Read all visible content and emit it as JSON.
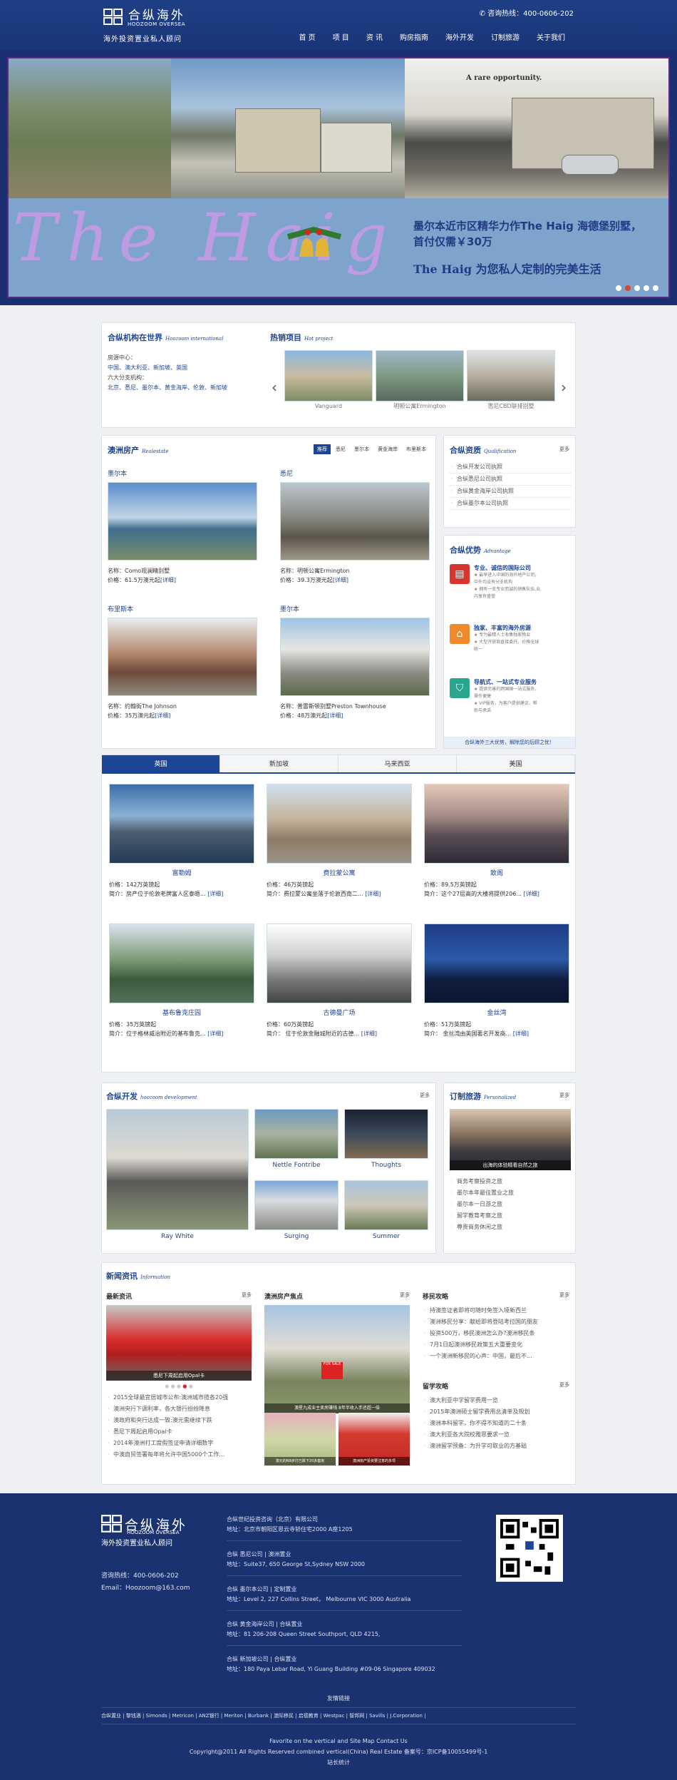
{
  "header": {
    "logo_cn": "合纵海外",
    "logo_en": "HOOZOOM OVERSEA",
    "slogan": "海外投资置业私人顾问",
    "hotline": "咨询热线：400-0606-202",
    "nav": [
      "首 页",
      "项 目",
      "资 讯",
      "购房指南",
      "海外开发",
      "订制旅游",
      "关于我们"
    ]
  },
  "banner": {
    "tagline": "A rare opportunity.",
    "big_text": "The Haig",
    "line1": "墨尔本近市区精华力作The Haig 海德堡别墅，首付仅需￥30万",
    "line2": "The Haig 为您私人定制的完美生活",
    "slides": 5,
    "active": 2
  },
  "intl": {
    "title": "合纵机构在世界",
    "en": "Hoozoom international",
    "label1": "房源中心：",
    "countries1": "中国、澳大利亚、新加坡、英国",
    "label2": "六大分支机构：",
    "countries2": "北京、悉尼、墨尔本、黄金海岸、伦敦、新加坡"
  },
  "hot": {
    "title": "热销项目",
    "en": "Hot project",
    "items": [
      "Vanguard",
      "明顿公寓Ermington",
      "悉尼CBD联排别墅"
    ]
  },
  "realestate": {
    "title": "澳洲房产",
    "en": "Realestate",
    "tabs": [
      "推荐",
      "悉尼",
      "墨尔本",
      "黄金海岸",
      "布里斯本"
    ],
    "items": [
      {
        "city": "墨尔本",
        "name": "名称：Como观澜精别墅",
        "price": "价格：61.5万澳元起",
        "detail": "[详细]"
      },
      {
        "city": "悉尼",
        "name": "名称：明顿公寓Ermington",
        "price": "价格：39.3万澳元起",
        "detail": "[详细]"
      },
      {
        "city": "布里斯本",
        "name": "名称：约翰街The Johnson",
        "price": "价格：35万澳元起",
        "detail": "[详细]"
      },
      {
        "city": "墨尔本",
        "name": "名称：普雷斯顿别墅Preston Townhouse",
        "price": "价格：48万澳元起",
        "detail": "[详细]"
      }
    ]
  },
  "qual": {
    "title": "合纵资质",
    "en": "Qualification",
    "more": "更多",
    "items": [
      "合纵开发公司执照",
      "合纵悉尼公司执照",
      "合纵黄金海岸公司执照",
      "合纵墨尔本公司执照"
    ]
  },
  "adv": {
    "title": "合纵优势",
    "en": "Advantage",
    "items": [
      {
        "h": "专业、诚信的国际公司",
        "d": [
          "★ 最早进入中国的海外地产公司，",
          "中外均设有分支机构",
          "★ 拥有一支专业而诚的销售队伍,业",
          "内享有盛誉"
        ]
      },
      {
        "h": "独家、丰富的海外房源",
        "d": [
          "★ 专为最精人士收集独家物业",
          "★ 大型开放商直接委托，价格全球",
          "统一"
        ]
      },
      {
        "h": "导航式、一站式专业服务",
        "d": [
          "★ 提供完善的跨国国一站式服务，",
          "操作便捷",
          "★ VIP服务，为客户提供建议，帮",
          "助与承诺"
        ]
      }
    ],
    "footer": "合纵海外三大优势，解除您的后顾之忧！"
  },
  "world": {
    "tabs": [
      "英国",
      "新加坡",
      "马来西亚",
      "美国"
    ],
    "items": [
      {
        "t": "富勒姆",
        "p": "价格：142万英镑起",
        "d": "简介：房产位于伦敦老牌富人区泰晤...",
        "x": "[详细]"
      },
      {
        "t": "费拉蒙公寓",
        "p": "价格：46万英镑起",
        "d": "简介：费拉蒙公寓坐落于伦敦西南二...",
        "x": "[详细]"
      },
      {
        "t": "致阁",
        "p": "价格：89.5万英镑起",
        "d": "简介：这个27层高的大楼将提供206...",
        "x": "[详细]"
      },
      {
        "t": "基布鲁克庄园",
        "p": "价格：35万英镑起",
        "d": "简介：位于格林威治附近的基布鲁克...",
        "x": "[详细]"
      },
      {
        "t": "古德曼广场",
        "p": "价格：60万英镑起",
        "d": "简介：  位于伦敦金融城附近的古德...",
        "x": "[详细]"
      },
      {
        "t": "金丝湾",
        "p": "价格：51万英镑起",
        "d": "简介：   金丝湾由英国著名开发商...",
        "x": "[详细]"
      }
    ]
  },
  "dev": {
    "title": "合纵开发",
    "en": "hoozoom development",
    "more": "更多",
    "items": [
      "Ray White",
      "Nettle Fontribe",
      "Thoughts",
      "Surging",
      "Summer"
    ]
  },
  "tour": {
    "title": "订制旅游",
    "en": "Personalized",
    "more": "更多",
    "img_cap": "出海的体验精看自然之旅",
    "items": [
      "商务考察投资之旅",
      "墨尔本年最佳置业之旅",
      "墨尔本一日游之旅",
      "留学教育考察之旅",
      "尊贵商务休闲之旅"
    ]
  },
  "news": {
    "title": "新闻资讯",
    "en": "Information",
    "latest": {
      "title": "最新资讯",
      "more": "更多",
      "cap": "悉尼下周起启用Opal卡",
      "items": [
        "2015全球最宜居城市公布:澳洲城市揽各20强",
        "澳洲央行下调利率，各大银行纷纷降息",
        "澳政府和央行达成一致:澳元需继续下跌",
        "悉尼下周起启用Opal卡",
        "2014年澳洲打工度假签证申请详细数字",
        "中澳自贸签署每年将允许中国5000个工作..."
      ]
    },
    "focus": {
      "title": "澳洲房产焦点",
      "more": "更多",
      "cap1": "澳星九成业主卖房赚钱 8年半收入手还超一倍",
      "cap2": "澳元的NB步打已跌下20多套房",
      "cap3": "澳洲房产投资要注意的多项"
    },
    "immig": {
      "title": "移民攻略",
      "more": "更多",
      "items": [
        "持澳签证者即将可随时免签入境新西兰",
        "澳洲移民分享：献给即将登陆考拉国的朋友",
        "投资500万，移民澳洲怎么办?澳洲移民条",
        "7月1日起澳洲移民政策五大重要变化",
        "一个澳洲新移民的心声：中国，最后不..."
      ]
    },
    "study": {
      "title": "留学攻略",
      "more": "更多",
      "items": [
        "澳大利亚中学留学费用一览",
        "2015年澳洲硕士留学费用总清单及规划",
        "澳洲本科留学，你不得不知道的二十条",
        "澳大利亚各大院校雅思要求一览",
        "澳洲留学预备：为升学可取业的方基础"
      ]
    }
  },
  "footer": {
    "logo_cn": "合纵海外",
    "logo_en": "HOOZOOM OVERSEA",
    "slogan": "海外投资置业私人顾问",
    "hotline": "咨询热线：400-0606-202",
    "email": "Email：Hoozoom@163.com",
    "offices": [
      {
        "n": "合纵世纪投资咨询（北京）有限公司",
        "a": "地址：北京市朝阳区恩云寺轿住宅2000 A座1205"
      },
      {
        "n": "合纵 悉尼公司 | 澳洲置业",
        "a": "地址：Suite37, 650 George St,Sydney NSW 2000"
      },
      {
        "n": "合纵 墨尔本公司 | 定制置业",
        "a": "地址：Level 2, 227 Collins Street， Melbourne VIC 3000 Australia"
      },
      {
        "n": "合纵 黄金海岸公司 | 合纵置业",
        "a": "地址：81 206-208 Queen Street Southport, QLD 4215,"
      },
      {
        "n": "合纵 新加坡公司 | 合纵置业",
        "a": "地址：180 Paya Lebar Road, Yi Guang Building #09-06 Singapore 409032"
      }
    ],
    "links_title": "友情链接",
    "links": [
      "合纵置业",
      "黎钱酒",
      "Simonds",
      "Metricon",
      "ANZ银行",
      "Meriton",
      "Burbank",
      "澳际移民",
      "启德教育",
      "Westpac",
      "智邦网",
      "Savills",
      "J.Corporation"
    ],
    "b1": "Favorite on the vertical and Site Map Contact Us",
    "b2": "Copyright@2011 All Rights Reserved combined vertical(China) Real Estate   备案号：京ICP备10055499号-1",
    "b3": "站长统计"
  }
}
